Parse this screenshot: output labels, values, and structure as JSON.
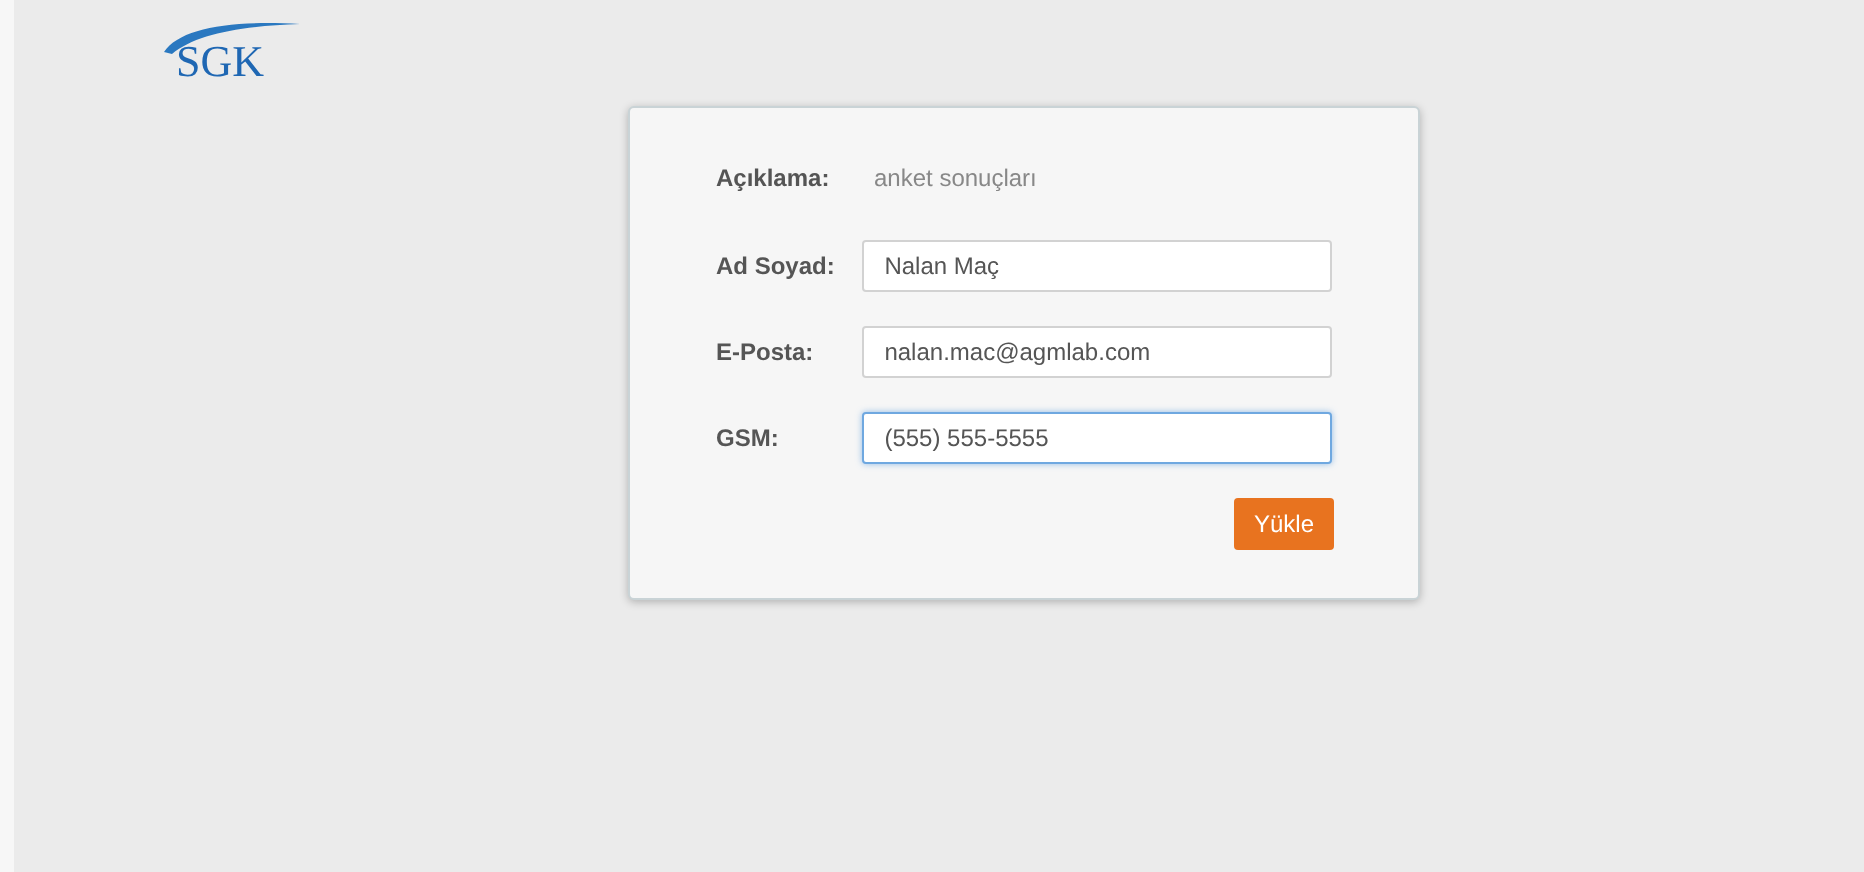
{
  "logo": {
    "text": "SGK"
  },
  "form": {
    "description": {
      "label": "Açıklama:",
      "value": "anket sonuçları"
    },
    "fields": [
      {
        "label": "Ad Soyad:",
        "value": "Nalan Maç",
        "focused": false
      },
      {
        "label": "E-Posta:",
        "value": "nalan.mac@agmlab.com",
        "focused": false
      },
      {
        "label": "GSM:",
        "value": "(555) 555-5555",
        "focused": true
      }
    ],
    "submit": "Yükle"
  }
}
